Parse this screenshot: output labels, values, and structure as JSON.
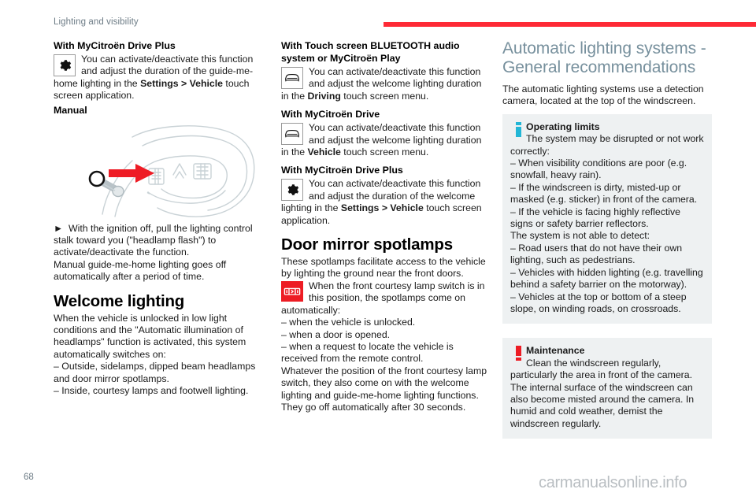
{
  "header": {
    "chapter_title": "Lighting and visibility",
    "rule_color": "#fe2a36"
  },
  "footer": {
    "page_number": "68",
    "watermark": "carmanualsonline.info"
  },
  "column1": {
    "heading_drive_plus": "With MyCitroën Drive Plus",
    "drive_plus_icon_text_1": "You can activate/deactivate this function and adjust the duration of the guide-me-",
    "drive_plus_text_rest": "home lighting in the ",
    "drive_plus_bold": "Settings > Vehicle",
    "drive_plus_text_rest2": " touch screen application.",
    "heading_manual": "Manual",
    "illustration_caption": "steering wheel with lighting control stalk",
    "bullet_arrow": "►",
    "manual_step": "With the ignition off, pull the lighting control stalk toward you (\"headlamp flash\") to activate/deactivate the function.",
    "manual_note": "Manual guide-me-home lighting goes off automatically after a period of time.",
    "heading_welcome": "Welcome lighting",
    "welcome_intro": "When the vehicle is unlocked in low light conditions and the \"Automatic illumination of headlamps\" function is activated, this system automatically switches on:",
    "welcome_item_1": "– Outside, sidelamps, dipped beam headlamps and door mirror spotlamps.",
    "welcome_item_2": "– Inside, courtesy lamps and footwell lighting."
  },
  "column2": {
    "heading_bluetooth": "With Touch screen BLUETOOTH audio system or MyCitroën Play",
    "bluetooth_icon_text": "You can activate/deactivate this function and adjust the welcome lighting duration",
    "bluetooth_rest_pre": "in the ",
    "bluetooth_rest_bold": "Driving",
    "bluetooth_rest_post": " touch screen menu.",
    "heading_drive": "With MyCitroën Drive",
    "drive_icon_text": "You can activate/deactivate this function and adjust the welcome lighting duration",
    "drive_rest_pre": "in the ",
    "drive_rest_bold": "Vehicle",
    "drive_rest_post": " touch screen menu.",
    "heading_drive_plus": "With MyCitroën Drive Plus",
    "drive_plus_icon_text": "You can activate/deactivate this function and adjust the duration of the welcome",
    "drive_plus_rest_pre": "lighting in the ",
    "drive_plus_rest_bold": "Settings > Vehicle",
    "drive_plus_rest_post": " touch screen application.",
    "heading_spotlamps": "Door mirror spotlamps",
    "spotlamps_intro": "These spotlamps facilitate access to the vehicle by lighting the ground near the front doors.",
    "spotlamps_icon_text": "When the front courtesy lamp switch is in this position, the spotlamps come on",
    "spotlamps_auto": "automatically:",
    "spotlamps_item_1": "– when the vehicle is unlocked.",
    "spotlamps_item_2": "– when a door is opened.",
    "spotlamps_item_3": "– when a request to locate the vehicle is received from the remote control.",
    "spotlamps_outro": "Whatever the position of the front courtesy lamp switch, they also come on with the welcome lighting and guide-me-home lighting functions. They go off automatically after 30 seconds."
  },
  "column3": {
    "heading_auto_lighting": "Automatic lighting systems - General recommendations",
    "intro": "The automatic lighting systems use a detection camera, located at the top of the windscreen.",
    "info_box": {
      "title": "Operating limits",
      "lead": "The system may be disrupted or not work",
      "lead_cont": "correctly:",
      "items": [
        "– When visibility conditions are poor (e.g. snowfall, heavy rain).",
        "– If the windscreen is dirty, misted-up or masked (e.g. sticker) in front of the camera.",
        "– If the vehicle is facing highly reflective signs or safety barrier reflectors."
      ],
      "subhead": "The system is not able to detect:",
      "items2": [
        "– Road users that do not have their own lighting, such as pedestrians.",
        "– Vehicles with hidden lighting (e.g. travelling behind a safety barrier on the motorway).",
        "– Vehicles at the top or bottom of a steep slope, on winding roads, on crossroads."
      ]
    },
    "maintenance_box": {
      "title": "Maintenance",
      "lead": "Clean the windscreen regularly,",
      "body": "particularly the area in front of the camera. The internal surface of the windscreen can also become misted around the camera. In humid and cold weather, demist the windscreen regularly."
    }
  },
  "icons": {
    "gear": "gear-icon",
    "car": "car-front-icon",
    "courtesy_lamp": "courtesy-lamp-icon",
    "info": "info-bar-icon",
    "warning": "exclamation-icon"
  },
  "colors": {
    "accent_red": "#ed1c24",
    "heading_blue_grey": "#77909d",
    "callout_bg": "#eef1f2",
    "info_cyan": "#22b6d6"
  }
}
